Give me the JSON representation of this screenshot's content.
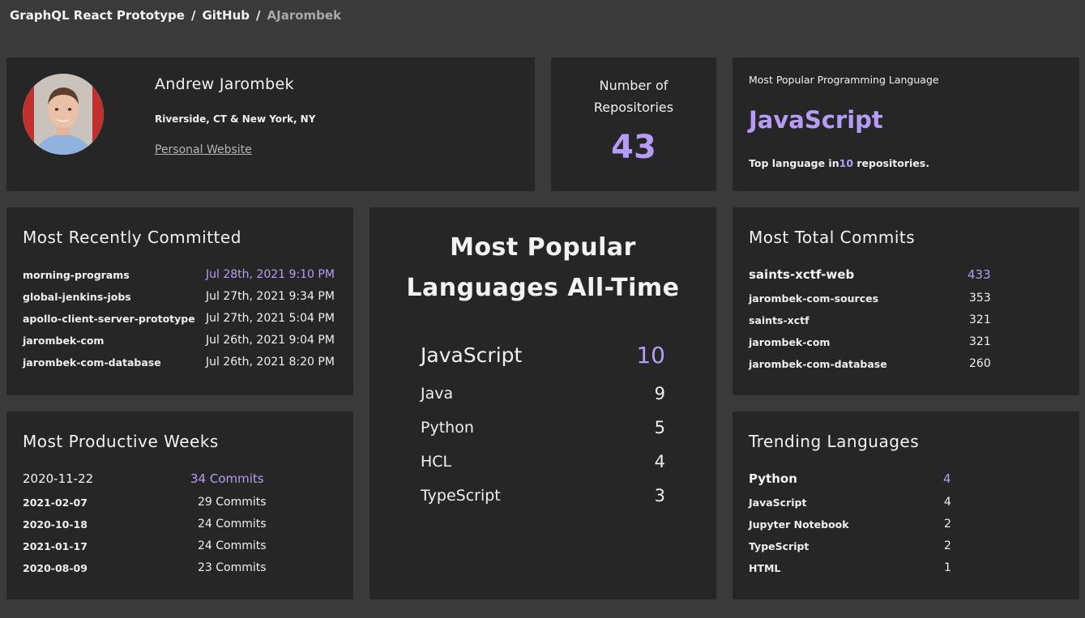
{
  "breadcrumb": {
    "items": [
      "GraphQL React Prototype",
      "GitHub"
    ],
    "current": "AJarombek"
  },
  "profile": {
    "name": "Andrew Jarombek",
    "location": "Riverside, CT & New York, NY",
    "website_label": "Personal Website"
  },
  "repositories": {
    "label_line1": "Number of",
    "label_line2": "Repositories",
    "count": "43"
  },
  "popular_language": {
    "label": "Most Popular Programming Language",
    "language": "JavaScript",
    "top_prefix": "Top language in",
    "top_count": "10",
    "top_suffix": " repositories."
  },
  "recently_committed": {
    "title": "Most Recently Committed",
    "rows": [
      {
        "repo": "morning-programs",
        "date": "Jul 28th, 2021 9:10 PM"
      },
      {
        "repo": "global-jenkins-jobs",
        "date": "Jul 27th, 2021 9:34 PM"
      },
      {
        "repo": "apollo-client-server-prototype",
        "date": "Jul 27th, 2021 5:04 PM"
      },
      {
        "repo": "jarombek-com",
        "date": "Jul 26th, 2021 9:04 PM"
      },
      {
        "repo": "jarombek-com-database",
        "date": "Jul 26th, 2021 8:20 PM"
      }
    ]
  },
  "popular_all_time": {
    "title_line1": "Most Popular",
    "title_line2": "Languages All-Time",
    "rows": [
      {
        "language": "JavaScript",
        "count": "10"
      },
      {
        "language": "Java",
        "count": "9"
      },
      {
        "language": "Python",
        "count": "5"
      },
      {
        "language": "HCL",
        "count": "4"
      },
      {
        "language": "TypeScript",
        "count": "3"
      }
    ]
  },
  "total_commits": {
    "title": "Most Total Commits",
    "rows": [
      {
        "repo": "saints-xctf-web",
        "count": "433"
      },
      {
        "repo": "jarombek-com-sources",
        "count": "353"
      },
      {
        "repo": "saints-xctf",
        "count": "321"
      },
      {
        "repo": "jarombek-com",
        "count": "321"
      },
      {
        "repo": "jarombek-com-database",
        "count": "260"
      }
    ]
  },
  "productive_weeks": {
    "title": "Most Productive Weeks",
    "rows": [
      {
        "week": "2020-11-22",
        "commits": "34 Commits"
      },
      {
        "week": "2021-02-07",
        "commits": "29 Commits"
      },
      {
        "week": "2020-10-18",
        "commits": "24 Commits"
      },
      {
        "week": "2021-01-17",
        "commits": "24 Commits"
      },
      {
        "week": "2020-08-09",
        "commits": "23 Commits"
      }
    ]
  },
  "trending": {
    "title": "Trending Languages",
    "rows": [
      {
        "language": "Python",
        "count": "4"
      },
      {
        "language": "JavaScript",
        "count": "4"
      },
      {
        "language": "Jupyter Notebook",
        "count": "2"
      },
      {
        "language": "TypeScript",
        "count": "2"
      },
      {
        "language": "HTML",
        "count": "1"
      }
    ]
  },
  "colors": {
    "accent": "#b79cf5",
    "card": "#262626",
    "background": "#3a3a3a"
  }
}
